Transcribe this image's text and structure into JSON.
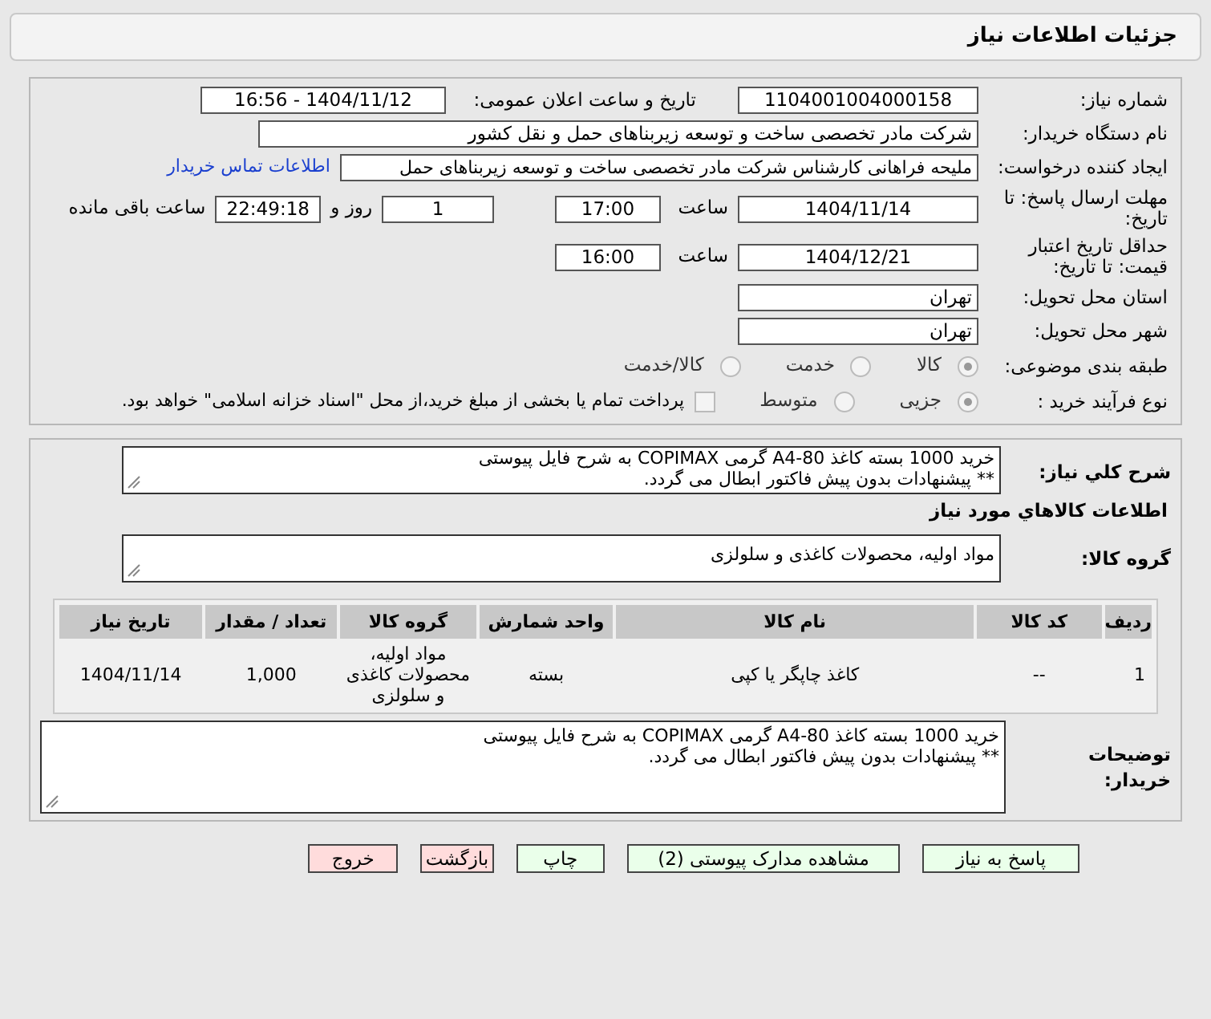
{
  "title": "جزئیات اطلاعات نیاز",
  "need_number": {
    "label": "شماره نیاز:",
    "value": "1104001004000158"
  },
  "announce": {
    "label": "تاریخ و ساعت اعلان عمومی:",
    "value": "1404/11/12 - 16:56"
  },
  "buyer": {
    "label": "نام دستگاه خریدار:",
    "value": "شرکت مادر تخصصی ساخت و توسعه زیربناهای حمل و نقل کشور"
  },
  "creator": {
    "label": "ایجاد کننده درخواست:",
    "value": "ملیحه فراهانی کارشناس شرکت مادر تخصصی ساخت و توسعه زیربناهای حمل",
    "link": "اطلاعات تماس خریدار"
  },
  "deadline": {
    "label": "مهلت ارسال پاسخ: تا تاریخ:",
    "date": "1404/11/14",
    "time_label": "ساعت",
    "time": "17:00",
    "days": "1",
    "days_label": "روز و",
    "remaining": "22:49:18",
    "remaining_label": "ساعت باقی مانده"
  },
  "validity": {
    "label": "حداقل تاریخ اعتبار قیمت: تا تاریخ:",
    "date": "1404/12/21",
    "time_label": "ساعت",
    "time": "16:00"
  },
  "province": {
    "label": "استان محل تحویل:",
    "value": "تهران"
  },
  "city": {
    "label": "شهر محل تحویل:",
    "value": "تهران"
  },
  "category": {
    "label": "طبقه بندی موضوعی:",
    "options": [
      {
        "label": "کالا",
        "selected": true
      },
      {
        "label": "خدمت",
        "selected": false
      },
      {
        "label": "کالا/خدمت",
        "selected": false
      }
    ]
  },
  "process": {
    "label": "نوع فرآیند خرید :",
    "options": [
      {
        "label": "جزیی",
        "selected": true
      },
      {
        "label": "متوسط",
        "selected": false
      }
    ],
    "payment": {
      "label": "پرداخت تمام یا بخشی از مبلغ خرید،از محل \"اسناد خزانه اسلامی\" خواهد بود.",
      "checked": false
    }
  },
  "description": {
    "label": "شرح كلي نياز:",
    "value": "خرید 1000 بسته کاغذ A4-80 گرمی COPIMAX به شرح فایل پیوستی\n** پیشنهادات بدون پیش فاکتور ابطال می گردد."
  },
  "goods_heading": "اطلاعات كالاهاي مورد نياز",
  "goods_group": {
    "label": "گروه کالا:",
    "value": "مواد اولیه، محصولات کاغذی و سلولزی"
  },
  "table": {
    "columns": [
      "ردیف",
      "کد کالا",
      "نام کالا",
      "واحد شمارش",
      "گروه کالا",
      "تعداد / مقدار",
      "تاریخ نیاز"
    ],
    "rows": [
      [
        "1",
        "--",
        "کاغذ چاپگر یا کپی",
        "بسته",
        "مواد اولیه، محصولات کاغذی و سلولزی",
        "1,000",
        "1404/11/14"
      ]
    ]
  },
  "notes": {
    "label": "توضیحات خریدار:",
    "value": "خرید 1000 بسته کاغذ A4-80 گرمی COPIMAX به شرح فایل پیوستی\n** پیشنهادات بدون پیش فاکتور ابطال می گردد."
  },
  "buttons": [
    {
      "label": "پاسخ به نیاز",
      "kind": "primary"
    },
    {
      "label": "مشاهده مدارک پیوستی (2)",
      "kind": "primary"
    },
    {
      "label": "چاپ",
      "kind": "primary"
    },
    {
      "label": "بازگشت",
      "kind": "danger"
    },
    {
      "label": "خروج",
      "kind": "danger"
    }
  ]
}
